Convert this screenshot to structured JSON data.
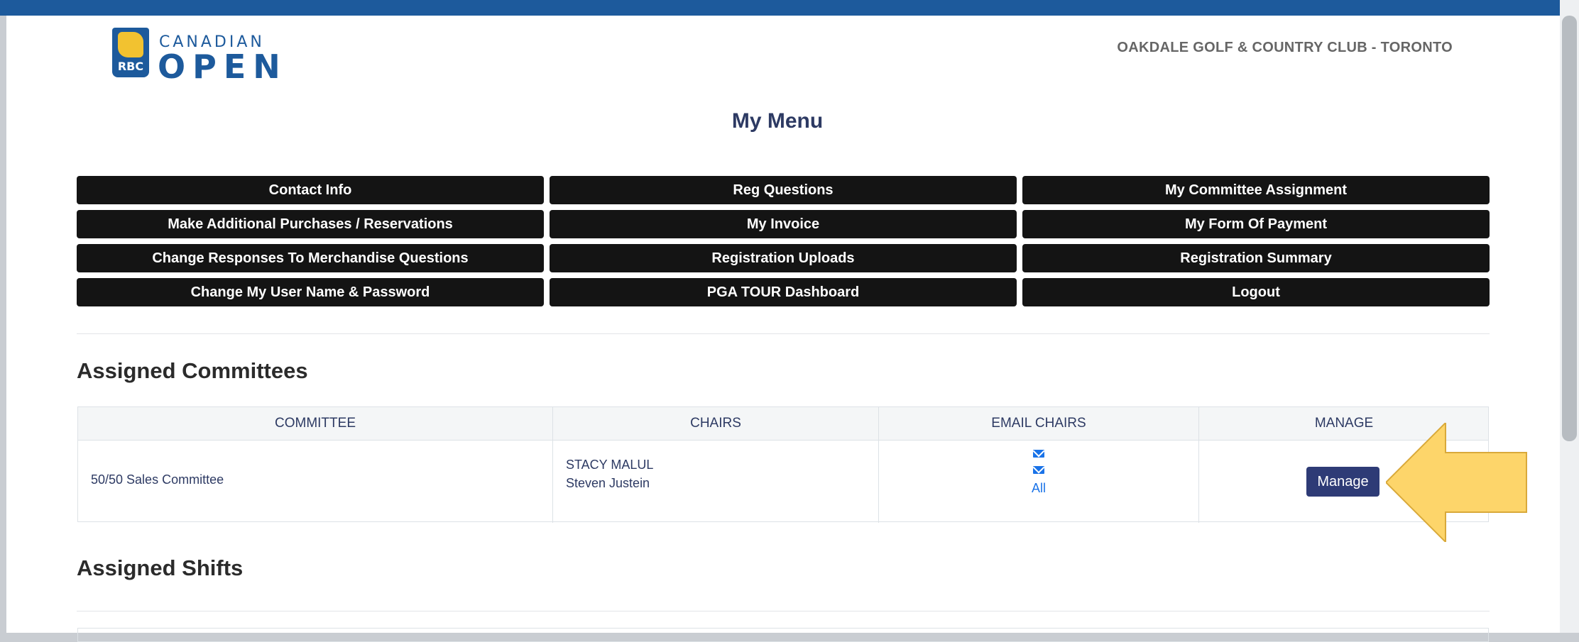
{
  "header": {
    "logo": {
      "brand": "RBC",
      "line1": "CANADIAN",
      "line2": "OPEN"
    },
    "venue": "OAKDALE GOLF & COUNTRY CLUB - TORONTO"
  },
  "menu": {
    "title": "My Menu",
    "items": [
      "Contact Info",
      "Reg Questions",
      "My Committee Assignment",
      "Make Additional Purchases / Reservations",
      "My Invoice",
      "My Form Of Payment",
      "Change Responses To Merchandise Questions",
      "Registration Uploads",
      "Registration Summary",
      "Change My User Name & Password",
      "PGA TOUR Dashboard",
      "Logout"
    ]
  },
  "assigned_committees": {
    "title": "Assigned Committees",
    "columns": [
      "COMMITTEE",
      "CHAIRS",
      "EMAIL CHAIRS",
      "MANAGE"
    ],
    "rows": [
      {
        "committee": "50/50 Sales Committee",
        "chairs": [
          "STACY MALUL",
          "Steven Justein"
        ],
        "email_all": "All",
        "manage_label": "Manage"
      }
    ]
  },
  "assigned_shifts": {
    "title": "Assigned Shifts"
  },
  "colors": {
    "brand_blue": "#1d5a9c",
    "menu_button": "#141414",
    "manage_button": "#2e3b76",
    "link": "#1a73e8",
    "highlight_arrow": "#fdd56a"
  }
}
